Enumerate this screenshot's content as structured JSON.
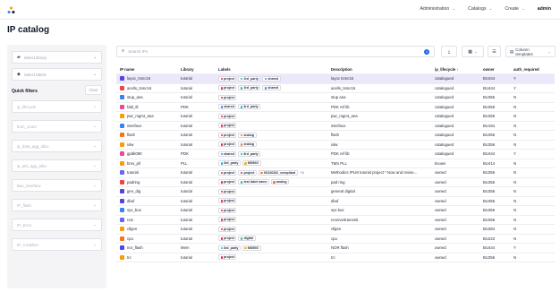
{
  "nav": {
    "administration": "Administration",
    "catalogs": "Catalogs",
    "create": "Create",
    "user": "admin"
  },
  "page_title": "IP catalog",
  "left": {
    "select_library": "Select library",
    "select_labels": "Select labels",
    "quick_filters_title": "Quick filters",
    "clear_label": "Clear",
    "filters": [
      "ip_lifecycle",
      "bom_count",
      "ip_data_agg_alloc",
      "ip_attr_agg_alloc",
      "Bus_interface",
      "IP_flash",
      "IP_Error",
      "IP_Codeline"
    ]
  },
  "search": {
    "placeholder": "Search IPs",
    "info": "i"
  },
  "toolbar": {
    "column_templates": "Column templates"
  },
  "table": {
    "headers": {
      "name": "IP name",
      "library": "Library",
      "labels": "Labels",
      "description": "Description",
      "lifecycle": "ip_lifecycle",
      "owner": "owner",
      "auth": "auth_required"
    },
    "sort_indicator": "↑",
    "rows": [
      {
        "name": "layoc_tsmc16",
        "icon_color": "#4f46e5",
        "library": "tutorial",
        "labels": [
          "project",
          "3rd_party",
          "shared"
        ],
        "more": "",
        "description": "layoc tsmc16",
        "lifecycle": "catalogued",
        "owner": "BU444",
        "auth": "Y"
      },
      {
        "name": "acells_tsmc16",
        "icon_color": "#ef4444",
        "library": "tutorial",
        "labels": [
          "project",
          "3rd_party",
          "shared"
        ],
        "more": "",
        "description": "acells_tsmc16",
        "lifecycle": "catalogued",
        "owner": "BU444",
        "auth": "Y"
      },
      {
        "name": "stup_ana",
        "icon_color": "#3b82f6",
        "library": "tutorial",
        "labels": [
          "project"
        ],
        "more": "",
        "description": "stup ana",
        "lifecycle": "catalogued",
        "owner": "BU356",
        "auth": "N"
      },
      {
        "name": "fabl_tll",
        "icon_color": "#ec4899",
        "library": "PDK",
        "labels": [
          "shared",
          "3rd_party"
        ],
        "more": "",
        "description": "PDK ref lib",
        "lifecycle": "catalogued",
        "owner": "BU356",
        "auth": "N"
      },
      {
        "name": "pwr_mgmt_ana",
        "icon_color": "#f59e0b",
        "library": "tutorial",
        "labels": [
          "project"
        ],
        "more": "",
        "description": "pwr_mgmt_ana",
        "lifecycle": "catalogued",
        "owner": "BU356",
        "auth": "N"
      },
      {
        "name": "interface",
        "icon_color": "#3b82f6",
        "library": "tutorial",
        "labels": [
          "project"
        ],
        "more": "",
        "description": "interface",
        "lifecycle": "catalogued",
        "owner": "BU194",
        "auth": "N"
      },
      {
        "name": "flash",
        "icon_color": "#f97316",
        "library": "tutorial",
        "labels": [
          "project",
          "analog"
        ],
        "more": "",
        "description": "flash",
        "lifecycle": "catalogued",
        "owner": "BU356",
        "auth": "N"
      },
      {
        "name": "iolw",
        "icon_color": "#f59e0b",
        "library": "tutorial",
        "labels": [
          "project",
          "analog"
        ],
        "more": "",
        "description": "iolw",
        "lifecycle": "catalogued",
        "owner": "BU356",
        "auth": "N"
      },
      {
        "name": "gpdk090",
        "icon_color": "#ec4899",
        "library": "PDK",
        "labels": [
          "shared",
          "3rd_party"
        ],
        "more": "",
        "description": "PDK ref lib",
        "lifecycle": "catalogued",
        "owner": "BU444",
        "auth": "Y"
      },
      {
        "name": "bms_pll",
        "icon_color": "#f59e0b",
        "library": "PLL",
        "labels": [
          "3rd_party",
          "MS90G"
        ],
        "more": "",
        "description": "TMS PLL",
        "lifecycle": "known",
        "owner": "BU414",
        "auth": "N"
      },
      {
        "name": "tutorial",
        "icon_color": "#6366f1",
        "library": "tutorial",
        "labels": [
          "project",
          "project",
          "ISO26262_compliant"
        ],
        "more": "+1",
        "description": "Methodics IPLM tutorial project * Now and revise...",
        "lifecycle": "owned",
        "owner": "BU356",
        "auth": "N"
      },
      {
        "name": "padring",
        "icon_color": "#ef4444",
        "library": "tutorial",
        "labels": [
          "project",
          "test label name",
          "analog"
        ],
        "more": "",
        "description": "pad ring",
        "lifecycle": "owned",
        "owner": "BU356",
        "auth": "N"
      },
      {
        "name": "gen_dig",
        "icon_color": "#4f46e5",
        "library": "tutorial",
        "labels": [
          "project"
        ],
        "more": "",
        "description": "general digital",
        "lifecycle": "owned",
        "owner": "BU356",
        "auth": "N"
      },
      {
        "name": "dbuf",
        "icon_color": "#4f46e5",
        "library": "tutorial",
        "labels": [
          "project"
        ],
        "more": "",
        "description": "dbuf",
        "lifecycle": "owned",
        "owner": "BU356",
        "auth": "N"
      },
      {
        "name": "sys_bus",
        "icon_color": "#3b82f6",
        "library": "tutorial",
        "labels": [
          "project"
        ],
        "more": "",
        "description": "sys bus",
        "lifecycle": "owned",
        "owner": "BU356",
        "auth": "N"
      },
      {
        "name": "rxtx",
        "icon_color": "#6366f1",
        "library": "tutorial",
        "labels": [
          "project"
        ],
        "more": "",
        "description": "receive/transmit",
        "lifecycle": "owned",
        "owner": "BU356",
        "auth": "N"
      },
      {
        "name": "cllgen",
        "icon_color": "#f59e0b",
        "library": "tutorial",
        "labels": [
          "project"
        ],
        "more": "",
        "description": "cllgen",
        "lifecycle": "owned",
        "owner": "BU384",
        "auth": "N"
      },
      {
        "name": "cpu",
        "icon_color": "#f97316",
        "library": "tutorial",
        "labels": [
          "project",
          "digital"
        ],
        "more": "",
        "description": "cpu",
        "lifecycle": "owned",
        "owner": "BU222",
        "auth": "N"
      },
      {
        "name": "nor_flash",
        "icon_color": "#4f46e5",
        "library": "Mem",
        "labels": [
          "3rd_party",
          "MS90G"
        ],
        "more": "",
        "description": "NOR flash",
        "lifecycle": "owned",
        "owner": "BU444",
        "auth": "Y"
      },
      {
        "name": "trc",
        "icon_color": "#f59e0b",
        "library": "tutorial",
        "labels": [
          "project"
        ],
        "more": "",
        "description": "trc",
        "lifecycle": "owned",
        "owner": "BU356",
        "auth": "N"
      }
    ]
  },
  "label_colors": {
    "project": "#e11d48",
    "3rd_party": "#06b6d4",
    "shared": "#3b82f6",
    "analog": "#f97316",
    "digital": "#22c55e",
    "MS90G": "#eab308",
    "ISO26262_compliant": "#f97316",
    "test label name": "#06b6d4"
  },
  "colors": {
    "accent": "#4f46e5",
    "selected_row": "#ece7fb"
  }
}
